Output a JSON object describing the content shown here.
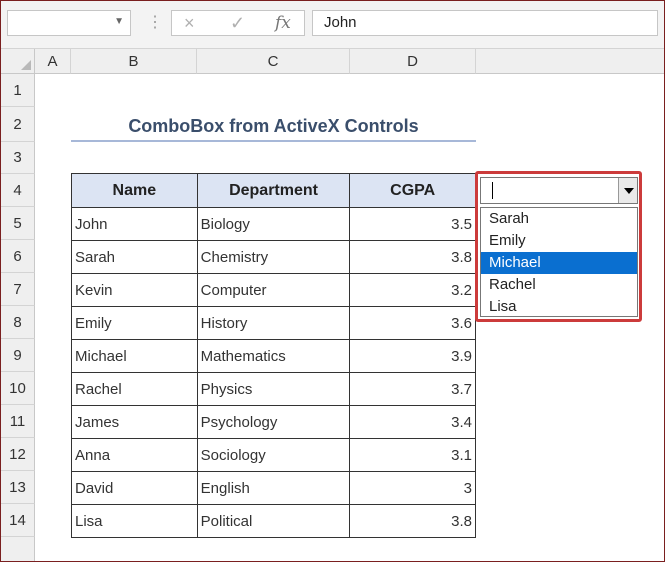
{
  "formula_bar": {
    "name_box_value": "",
    "cancel_icon": "×",
    "enter_icon": "✓",
    "fx_label": "fx",
    "formula_value": "John"
  },
  "columns": [
    "A",
    "B",
    "C",
    "D"
  ],
  "rows": [
    "1",
    "2",
    "3",
    "4",
    "5",
    "6",
    "7",
    "8",
    "9",
    "10",
    "11",
    "12",
    "13",
    "14"
  ],
  "sheet": {
    "title": "ComboBox from ActiveX Controls",
    "table": {
      "headers": [
        "Name",
        "Department",
        "CGPA"
      ],
      "rows": [
        [
          "John",
          "Biology",
          "3.5"
        ],
        [
          "Sarah",
          "Chemistry",
          "3.8"
        ],
        [
          "Kevin",
          "Computer",
          "3.2"
        ],
        [
          "Emily",
          "History",
          "3.6"
        ],
        [
          "Michael",
          "Mathematics",
          "3.9"
        ],
        [
          "Rachel",
          "Physics",
          "3.7"
        ],
        [
          "James",
          "Psychology",
          "3.4"
        ],
        [
          "Anna",
          "Sociology",
          "3.1"
        ],
        [
          "David",
          "English",
          "3"
        ],
        [
          "Lisa",
          "Political",
          "3.8"
        ]
      ]
    }
  },
  "combobox": {
    "value": "",
    "options": [
      "Sarah",
      "Emily",
      "Michael",
      "Rachel",
      "Lisa"
    ],
    "highlighted": "Michael",
    "highlight_color": "#0a6fd0",
    "outline_color": "#cc3b3b"
  }
}
